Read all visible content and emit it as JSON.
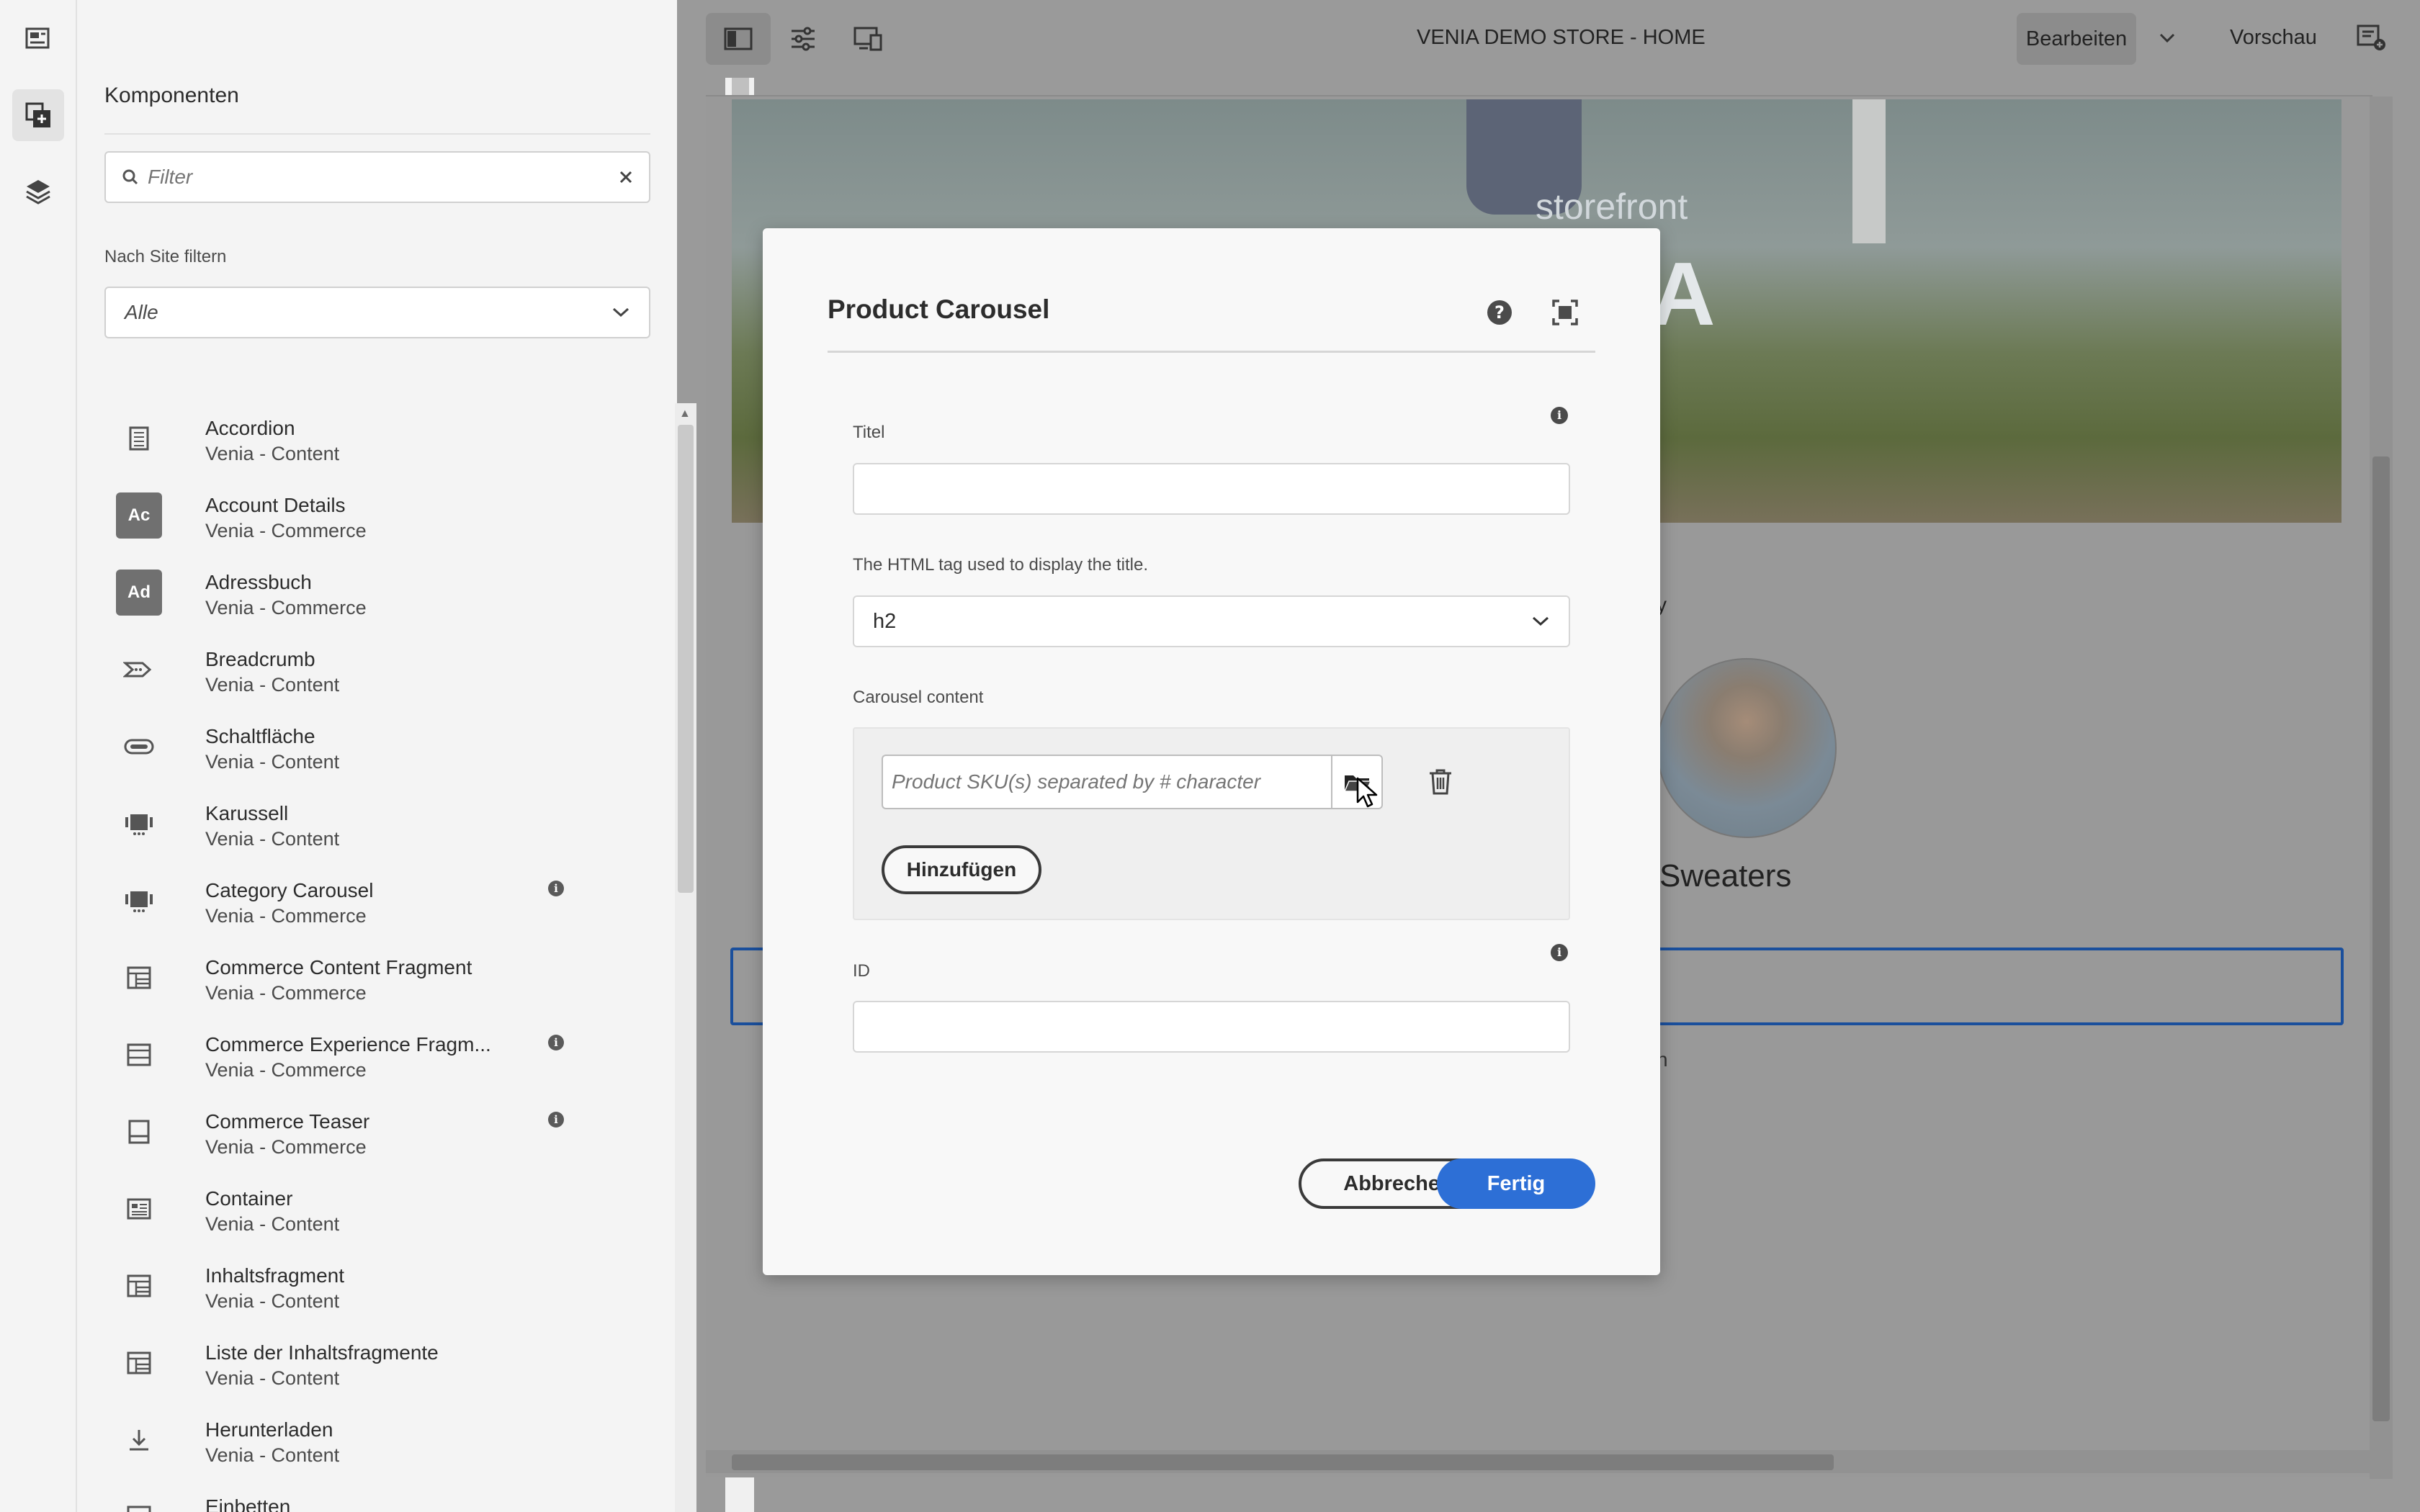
{
  "rail": {
    "items": [
      {
        "icon": "page-assets-icon"
      },
      {
        "icon": "components-icon",
        "active": true
      },
      {
        "icon": "layers-icon"
      }
    ]
  },
  "panel": {
    "title": "Komponenten",
    "search_placeholder": "Filter",
    "site_filter_label": "Nach Site filtern",
    "site_filter_value": "Alle",
    "components": [
      {
        "name": "Accordion",
        "group": "Venia - Content",
        "icon": "accordion-icon",
        "info": false
      },
      {
        "name": "Account Details",
        "group": "Venia - Commerce",
        "badge": "Ac",
        "info": false
      },
      {
        "name": "Adressbuch",
        "group": "Venia - Commerce",
        "badge": "Ad",
        "info": false
      },
      {
        "name": "Breadcrumb",
        "group": "Venia - Content",
        "icon": "breadcrumb-icon",
        "info": false
      },
      {
        "name": "Schaltfläche",
        "group": "Venia - Content",
        "icon": "button-icon",
        "info": false
      },
      {
        "name": "Karussell",
        "group": "Venia - Content",
        "icon": "carousel-icon",
        "info": false
      },
      {
        "name": "Category Carousel",
        "group": "Venia - Commerce",
        "icon": "carousel-icon",
        "info": true
      },
      {
        "name": "Commerce Content Fragment",
        "group": "Venia - Commerce",
        "icon": "fragment-icon",
        "info": false
      },
      {
        "name": "Commerce Experience Fragm...",
        "group": "Venia - Commerce",
        "icon": "experience-fragment-icon",
        "info": true
      },
      {
        "name": "Commerce Teaser",
        "group": "Venia - Commerce",
        "icon": "teaser-icon",
        "info": true
      },
      {
        "name": "Container",
        "group": "Venia - Content",
        "icon": "container-icon",
        "info": false
      },
      {
        "name": "Inhaltsfragment",
        "group": "Venia - Content",
        "icon": "fragment-icon",
        "info": false
      },
      {
        "name": "Liste der Inhaltsfragmente",
        "group": "Venia - Content",
        "icon": "fragment-list-icon",
        "info": false
      },
      {
        "name": "Herunterladen",
        "group": "Venia - Content",
        "icon": "download-icon",
        "info": false
      },
      {
        "name": "Einbetten",
        "group": "",
        "icon": "embed-icon",
        "info": false
      }
    ]
  },
  "topbar": {
    "page_title": "VENIA DEMO STORE - HOME",
    "mode_label": "Bearbeiten",
    "preview_label": "Vorschau"
  },
  "canvas": {
    "hero_text_small": "storefront",
    "hero_text_large": "NIA",
    "category_label": "Sweaters",
    "fragment_y": "y",
    "fragment_n": "n"
  },
  "dialog": {
    "title": "Product Carousel",
    "title_field_label": "Titel",
    "title_field_value": "",
    "html_tag_label": "The HTML tag used to display the title.",
    "html_tag_value": "h2",
    "carousel_label": "Carousel content",
    "sku_placeholder": "Product SKU(s) separated by # character",
    "add_label": "Hinzufügen",
    "id_label": "ID",
    "id_value": "",
    "cancel_label": "Abbrechen",
    "done_label": "Fertig"
  },
  "colors": {
    "primary": "#2d6fd6",
    "selection": "#1a4f9c"
  }
}
